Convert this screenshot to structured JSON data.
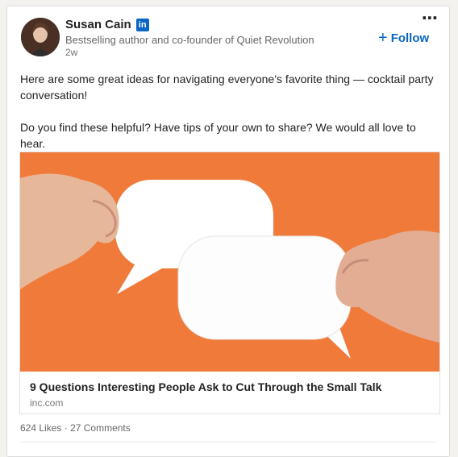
{
  "post": {
    "author_name": "Susan Cain",
    "network_badge": "in",
    "author_headline": "Bestselling author and co-founder of Quiet Revolution",
    "time_ago": "2w",
    "follow_label": "Follow",
    "more_icon": "⋯",
    "text_paragraphs": [
      "Here are some great ideas for navigating everyone’s favorite thing — cocktail party conversation!",
      "Do you find these helpful? Have tips of your own to share? We would all love to hear."
    ]
  },
  "article": {
    "title": "9 Questions Interesting People Ask to Cut Through the Small Talk",
    "source": "inc.com"
  },
  "social": {
    "likes": "624 Likes",
    "separator": "·",
    "comments": "27 Comments"
  },
  "colors": {
    "accent": "#0a66c2",
    "image_background": "#f07a3a"
  }
}
